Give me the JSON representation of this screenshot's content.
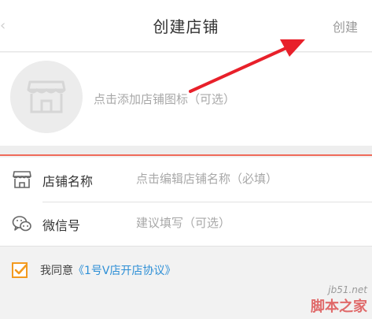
{
  "header": {
    "title": "创建店铺",
    "create_label": "创建"
  },
  "logo": {
    "hint": "点击添加店铺图标（可选）"
  },
  "form": {
    "shop_name": {
      "label": "店铺名称",
      "placeholder": "点击编辑店铺名称（必填）"
    },
    "wechat": {
      "label": "微信号",
      "placeholder": "建议填写（可选）"
    }
  },
  "agreement": {
    "checked": true,
    "prefix": "我同意",
    "link": "《1号V店开店协议》"
  },
  "watermark": {
    "url": "jb51.net",
    "name": "脚本之家"
  },
  "colors": {
    "accent_orange": "#f39a1f",
    "link_blue": "#2d8fd6",
    "annotation_red": "#e8202a",
    "divider_red": "#ef6a5a"
  }
}
